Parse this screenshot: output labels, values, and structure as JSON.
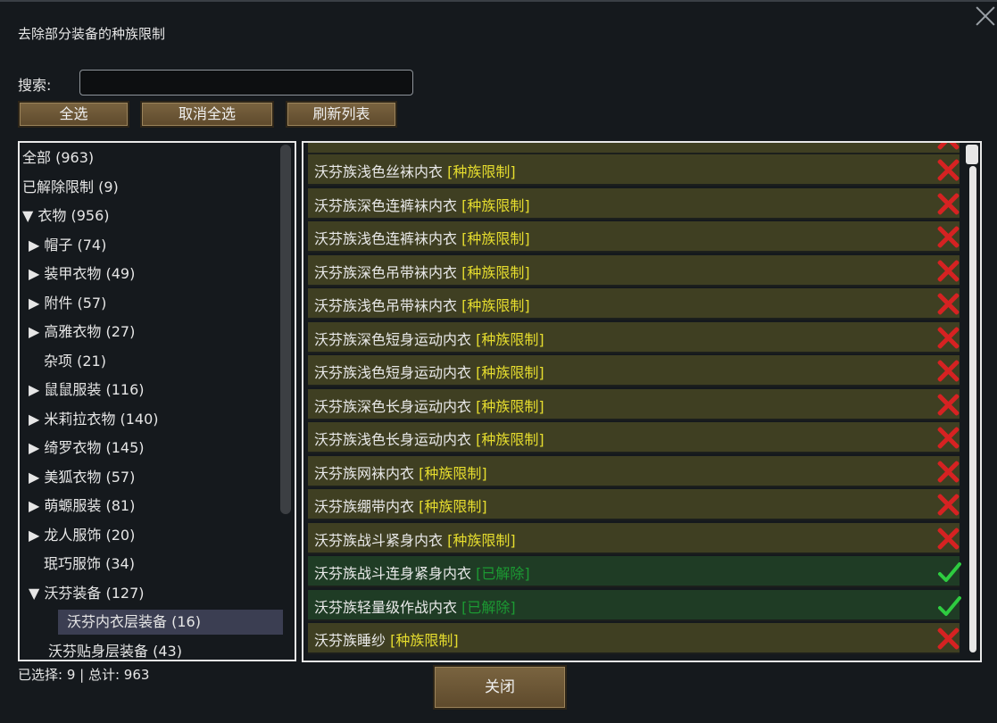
{
  "title": "去除部分装备的种族限制",
  "search": {
    "label": "搜索:",
    "value": "",
    "placeholder": ""
  },
  "buttons": {
    "select_all": "全选",
    "deselect_all": "取消全选",
    "refresh": "刷新列表",
    "close": "关闭"
  },
  "tree": [
    {
      "label": "全部 (963)",
      "arrow": "",
      "indent": 0
    },
    {
      "label": "已解除限制 (9)",
      "arrow": "",
      "indent": 0
    },
    {
      "label": "▼ 衣物 (956)",
      "arrow": "",
      "indent": 1
    },
    {
      "label": "▶ 帽子 (74)",
      "arrow": "",
      "indent": 2
    },
    {
      "label": "▶ 装甲衣物 (49)",
      "arrow": "",
      "indent": 2
    },
    {
      "label": "▶ 附件 (57)",
      "arrow": "",
      "indent": 2
    },
    {
      "label": "▶ 高雅衣物 (27)",
      "arrow": "",
      "indent": 2
    },
    {
      "label": "杂项 (21)",
      "arrow": "",
      "indent": 3
    },
    {
      "label": "▶ 鼠鼠服装 (116)",
      "arrow": "",
      "indent": 2
    },
    {
      "label": "▶ 米莉拉衣物 (140)",
      "arrow": "",
      "indent": 2
    },
    {
      "label": "▶ 绮罗衣物 (145)",
      "arrow": "",
      "indent": 2
    },
    {
      "label": "▶ 美狐衣物 (57)",
      "arrow": "",
      "indent": 2
    },
    {
      "label": "▶ 萌螈服装 (81)",
      "arrow": "",
      "indent": 2
    },
    {
      "label": "▶ 龙人服饰 (20)",
      "arrow": "",
      "indent": 2
    },
    {
      "label": "珉巧服饰 (34)",
      "arrow": "",
      "indent": 3
    },
    {
      "label": "▼ 沃芬装备 (127)",
      "arrow": "",
      "indent": 2
    },
    {
      "label": "沃芬内衣层装备 (16)",
      "arrow": "",
      "indent": 4,
      "selected": true
    },
    {
      "label": "沃芬贴身层装备 (43)",
      "arrow": "",
      "indent": 4
    }
  ],
  "items": [
    {
      "name": "沃芬族浅色丝袜内衣",
      "tag": "[种族限制]",
      "unlocked": false
    },
    {
      "name": "沃芬族深色连裤袜内衣",
      "tag": "[种族限制]",
      "unlocked": false
    },
    {
      "name": "沃芬族浅色连裤袜内衣",
      "tag": "[种族限制]",
      "unlocked": false
    },
    {
      "name": "沃芬族深色吊带袜内衣",
      "tag": "[种族限制]",
      "unlocked": false
    },
    {
      "name": "沃芬族浅色吊带袜内衣",
      "tag": "[种族限制]",
      "unlocked": false
    },
    {
      "name": "沃芬族深色短身运动内衣",
      "tag": "[种族限制]",
      "unlocked": false
    },
    {
      "name": "沃芬族浅色短身运动内衣",
      "tag": "[种族限制]",
      "unlocked": false
    },
    {
      "name": "沃芬族深色长身运动内衣",
      "tag": "[种族限制]",
      "unlocked": false
    },
    {
      "name": "沃芬族浅色长身运动内衣",
      "tag": "[种族限制]",
      "unlocked": false
    },
    {
      "name": "沃芬族网袜内衣",
      "tag": "[种族限制]",
      "unlocked": false
    },
    {
      "name": "沃芬族绷带内衣",
      "tag": "[种族限制]",
      "unlocked": false
    },
    {
      "name": "沃芬族战斗紧身内衣",
      "tag": "[种族限制]",
      "unlocked": false
    },
    {
      "name": "沃芬族战斗连身紧身内衣",
      "tag": "[已解除]",
      "unlocked": true
    },
    {
      "name": "沃芬族轻量级作战内衣",
      "tag": "[已解除]",
      "unlocked": true
    },
    {
      "name": "沃芬族睡纱",
      "tag": "[种族限制]",
      "unlocked": false
    }
  ],
  "footer": "已选择: 9 | 总计: 963",
  "colors": {
    "restricted_tag": "#e6dd2e",
    "unlocked_tag": "#1c9a33",
    "x_mark": "#d62222",
    "check_mark": "#2ecc40",
    "row_restricted": "#3f3f22",
    "row_unlocked": "#1f3c25"
  }
}
